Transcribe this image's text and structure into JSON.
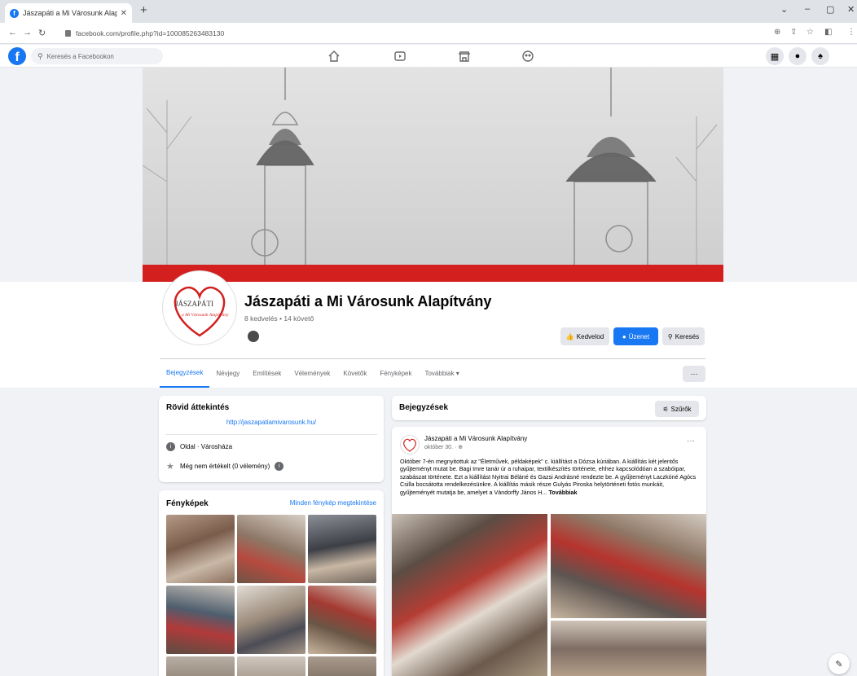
{
  "browser": {
    "tab_title": "Jászapáti a Mi Városunk Alapítv...",
    "url": "facebook.com/profile.php?id=100085263483130"
  },
  "fb": {
    "search_placeholder": "Keresés a Facebookon"
  },
  "page": {
    "name": "Jászapáti a Mi Városunk Alapítvány",
    "stats": "8 kedvelés • 14 követő",
    "logo_text_top": "JÁSZAPÁTI",
    "logo_text_bottom": "a Mi Városunk Alapítvány",
    "buttons": {
      "like": "Kedvelod",
      "message": "Üzenet",
      "search": "Keresés"
    },
    "tabs": [
      "Bejegyzések",
      "Névjegy",
      "Említések",
      "Vélemények",
      "Követők",
      "Fényképek",
      "Továbbiak ▾"
    ],
    "more_label": "···"
  },
  "intro": {
    "title": "Rövid áttekintés",
    "link": "http://jaszapatiamivarosunk.hu/",
    "type_text": "Oldal · Városháza",
    "rating_text": "Még nem értékelt (0 vélemény)"
  },
  "photos": {
    "title": "Fényképek",
    "see_all": "Minden fénykép megtekintése"
  },
  "posts": {
    "title": "Bejegyzések",
    "filter_label": "Szűrők",
    "post": {
      "author": "Jászapáti a Mi Városunk Alapítvány",
      "date": "október 30. · ",
      "text": "Október 7-én megnyitottuk az \"Életművek, példaképek\" c. kiállítást a  Dózsa kúriában. A kiállítás két jelentős gyűjteményt mutat be. Bagi Imre tanár úr a ruhaipar, textilkészítés története, ehhez kapcsolódóan a szabóipar, szabászat története. Ezt a kiállítást Nyitrai Béláné és Gazsi Andrásné rendezte be. A gyűjteményt Laczkóné Agócs Csilla bocsátotta rendelkezésünkre. A kiállítás másik része Gulyás Piroska helytörténeti fotós munkáit, gyűjteményét mutatja be, amelyet a Vándorffy János H...",
      "see_more": "Továbbiak"
    }
  },
  "colors": {
    "brand_blue": "#1877f2",
    "cover_red": "#d3201f",
    "bg": "#f0f2f5"
  }
}
